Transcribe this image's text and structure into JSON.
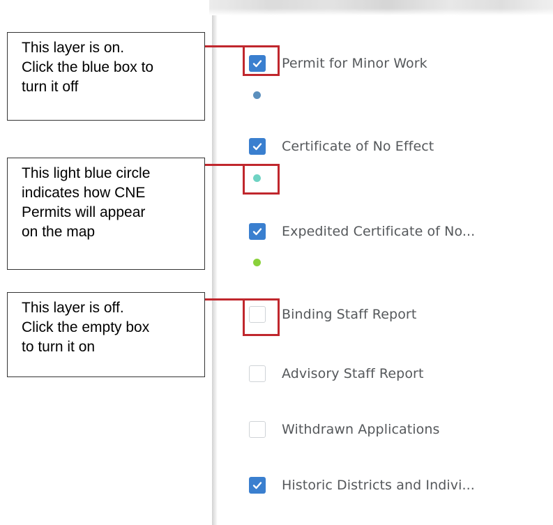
{
  "panel": {
    "layers": [
      {
        "label": "Permit for Minor Work",
        "checked": true,
        "legend_color": "#5b8fbd"
      },
      {
        "label": "Certificate of No Effect",
        "checked": true,
        "legend_color": "#6fd3c3"
      },
      {
        "label": "Expedited Certificate of No...",
        "checked": true,
        "legend_color": "#8ad13b"
      },
      {
        "label": "Binding Staff Report",
        "checked": false
      },
      {
        "label": "Advisory Staff Report",
        "checked": false
      },
      {
        "label": "Withdrawn Applications",
        "checked": false
      },
      {
        "label": "Historic Districts and Indivi...",
        "checked": true
      }
    ]
  },
  "callouts": {
    "layer_on": {
      "lines": [
        "This layer is on.",
        "Click the blue box to",
        "turn it off"
      ]
    },
    "legend_circle": {
      "lines": [
        "This light blue circle",
        "indicates how CNE",
        "Permits will appear",
        "on the map"
      ]
    },
    "layer_off": {
      "lines": [
        "This layer is off.",
        "Click the empty box",
        "to turn it on"
      ]
    }
  },
  "colors": {
    "checkbox_checked": "#3a7fcf",
    "callout_highlight": "#c0272d",
    "label_text": "#55585b"
  },
  "icons": {
    "checkmark": "checkmark-icon",
    "legend_dot": "circle-icon"
  }
}
